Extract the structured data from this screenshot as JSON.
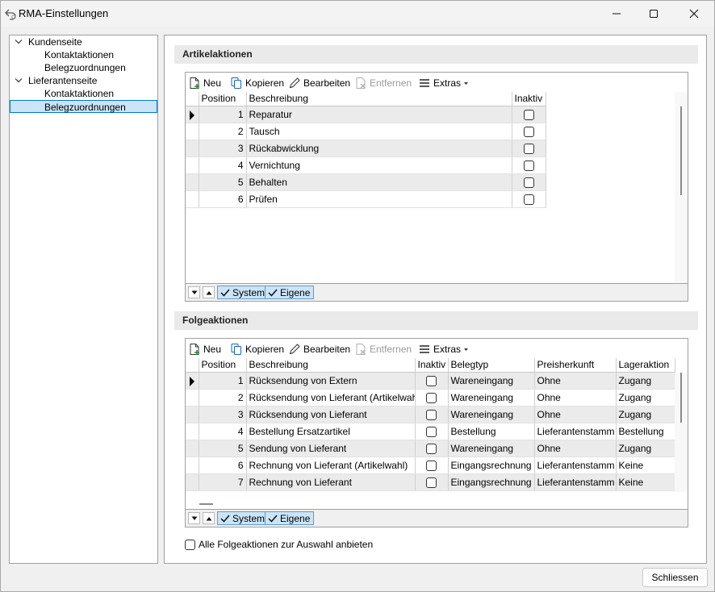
{
  "window": {
    "title": "RMA-Einstellungen",
    "icons": {
      "app": "back-arrow-app-icon",
      "minimize": "minimize-icon",
      "maximize": "maximize-icon",
      "close": "close-icon"
    }
  },
  "tree": {
    "groups": [
      {
        "label": "Kundenseite",
        "children": [
          "Kontaktaktionen",
          "Belegzuordnungen"
        ]
      },
      {
        "label": "Lieferantenseite",
        "children": [
          "Kontaktaktionen",
          "Belegzuordnungen"
        ]
      }
    ],
    "selected": "Lieferantenseite/Belegzuordnungen"
  },
  "toolbar": {
    "new": "Neu",
    "copy": "Kopieren",
    "edit": "Bearbeiten",
    "remove": "Entfernen",
    "extras": "Extras"
  },
  "bottombar": {
    "system": "System",
    "own": "Eigene"
  },
  "artikelaktionen": {
    "header": "Artikelaktionen",
    "columns": {
      "position": "Position",
      "description": "Beschreibung",
      "inactive": "Inaktiv"
    },
    "rows": [
      {
        "position": "1",
        "description": "Reparatur",
        "inactive": false
      },
      {
        "position": "2",
        "description": "Tausch",
        "inactive": false
      },
      {
        "position": "3",
        "description": "Rückabwicklung",
        "inactive": false
      },
      {
        "position": "4",
        "description": "Vernichtung",
        "inactive": false
      },
      {
        "position": "5",
        "description": "Behalten",
        "inactive": false
      },
      {
        "position": "6",
        "description": "Prüfen",
        "inactive": false
      }
    ]
  },
  "folgeaktionen": {
    "header": "Folgeaktionen",
    "columns": {
      "position": "Position",
      "description": "Beschreibung",
      "inactive": "Inaktiv",
      "doctype": "Belegtyp",
      "pricesource": "Preisherkunft",
      "stockaction": "Lageraktion"
    },
    "rows": [
      {
        "position": "1",
        "description": "Rücksendung von Extern",
        "inactive": false,
        "doctype": "Wareneingang",
        "pricesource": "Ohne",
        "stockaction": "Zugang"
      },
      {
        "position": "2",
        "description": "Rücksendung von Lieferant (Artikelwahl)",
        "inactive": false,
        "doctype": "Wareneingang",
        "pricesource": "Ohne",
        "stockaction": "Zugang"
      },
      {
        "position": "3",
        "description": "Rücksendung von Lieferant",
        "inactive": false,
        "doctype": "Wareneingang",
        "pricesource": "Ohne",
        "stockaction": "Zugang"
      },
      {
        "position": "4",
        "description": "Bestellung Ersatzartikel",
        "inactive": false,
        "doctype": "Bestellung",
        "pricesource": "Lieferantenstamm",
        "stockaction": "Bestellung"
      },
      {
        "position": "5",
        "description": "Sendung von Lieferant",
        "inactive": false,
        "doctype": "Wareneingang",
        "pricesource": "Ohne",
        "stockaction": "Zugang"
      },
      {
        "position": "6",
        "description": "Rechnung von Lieferant (Artikelwahl)",
        "inactive": false,
        "doctype": "Eingangsrechnung",
        "pricesource": "Lieferantenstamm",
        "stockaction": "Keine"
      },
      {
        "position": "7",
        "description": "Rechnung von Lieferant",
        "inactive": false,
        "doctype": "Eingangsrechnung",
        "pricesource": "Lieferantenstamm",
        "stockaction": "Keine"
      }
    ]
  },
  "option": {
    "label": "Alle Folgeaktionen zur Auswahl anbieten",
    "checked": false
  },
  "close_button": "Schliessen"
}
